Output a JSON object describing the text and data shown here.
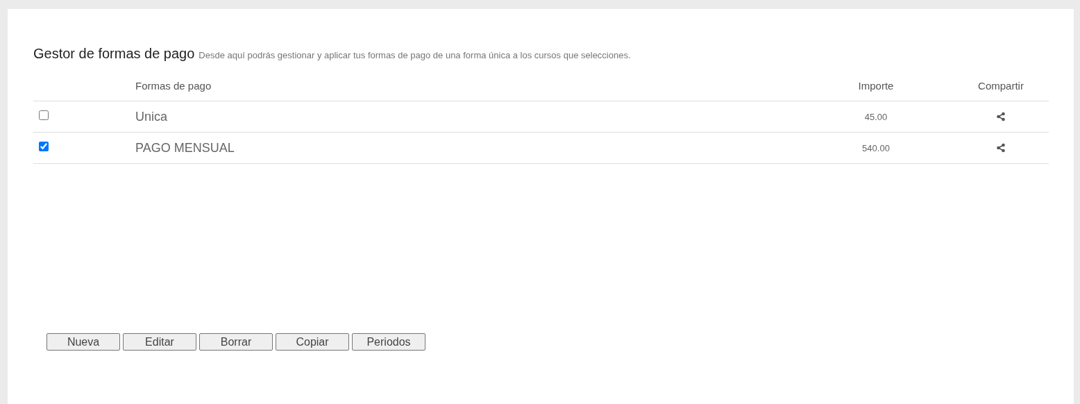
{
  "header": {
    "title": "Gestor de formas de pago",
    "subtitle": "Desde aquí podrás gestionar y aplicar tus formas de pago de una forma única a los cursos que selecciones."
  },
  "table": {
    "columns": [
      "Formas de pago",
      "Importe",
      "Compartir"
    ],
    "rows": [
      {
        "checked": false,
        "name": "Unica",
        "amount": "45.00"
      },
      {
        "checked": true,
        "name": "PAGO MENSUAL",
        "amount": "540.00"
      }
    ]
  },
  "buttons": [
    "Nueva",
    "Editar",
    "Borrar",
    "Copiar",
    "Periodos"
  ]
}
